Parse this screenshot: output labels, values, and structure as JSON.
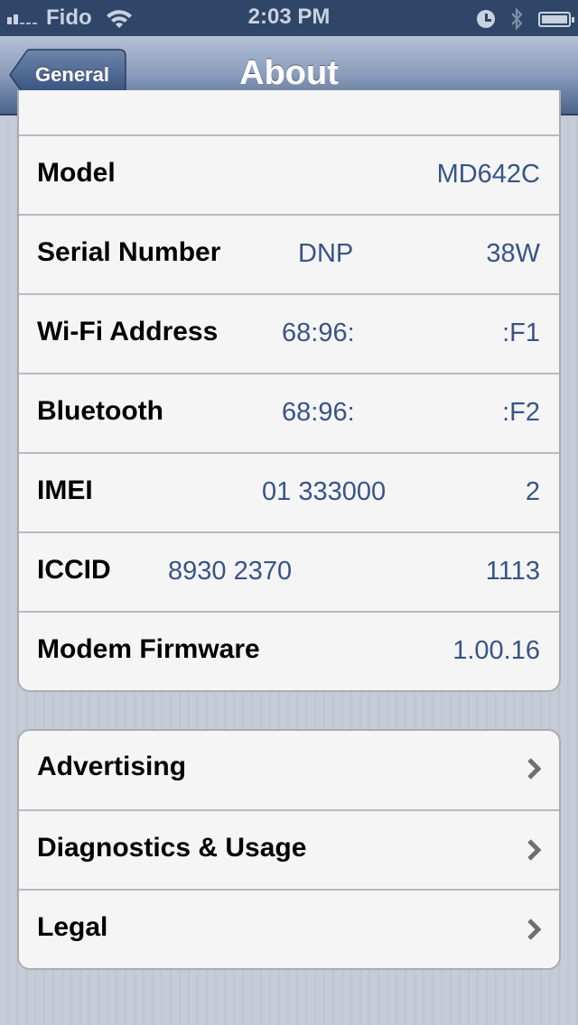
{
  "status_bar": {
    "carrier": "Fido",
    "signal_bars_filled": 2,
    "signal_bars_total": 5,
    "time": "2:03 PM",
    "icons": [
      "signal-icon",
      "wifi-icon",
      "alarm-clock-icon",
      "bluetooth-icon",
      "battery-icon"
    ]
  },
  "nav": {
    "back_label": "General",
    "title": "About"
  },
  "device_info": [
    {
      "label": "Model",
      "value_left": "",
      "value_right": "MD642C"
    },
    {
      "label": "Serial Number",
      "value_left": "DNP",
      "value_right": "38W"
    },
    {
      "label": "Wi-Fi Address",
      "value_left": "68:96:",
      "value_right": ":F1"
    },
    {
      "label": "Bluetooth",
      "value_left": "68:96:",
      "value_right": ":F2"
    },
    {
      "label": "IMEI",
      "value_left": "01 333000",
      "value_right": "2"
    },
    {
      "label": "ICCID",
      "value_left": "8930 2370",
      "value_right": "1113"
    },
    {
      "label": "Modem Firmware",
      "value_left": "",
      "value_right": "1.00.16"
    }
  ],
  "links": [
    {
      "label": "Advertising",
      "icon": "chevron-right-icon"
    },
    {
      "label": "Diagnostics & Usage",
      "icon": "chevron-right-icon"
    },
    {
      "label": "Legal",
      "icon": "chevron-right-icon"
    }
  ],
  "colors": {
    "status_bar": "#2f4668",
    "value_text": "#385487",
    "cell_background": "#f5f5f5"
  }
}
